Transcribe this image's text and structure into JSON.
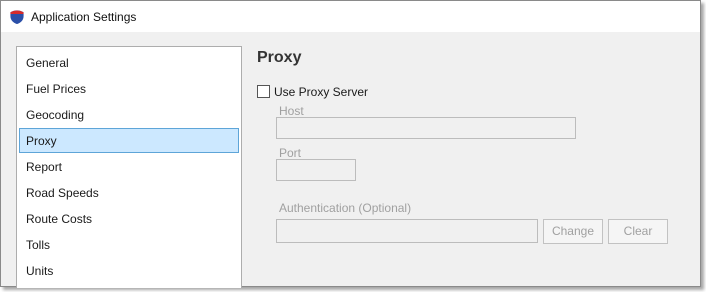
{
  "window": {
    "title": "Application Settings",
    "icon": "interstate-shield-icon"
  },
  "sidebar": {
    "items": [
      {
        "label": "General"
      },
      {
        "label": "Fuel Prices"
      },
      {
        "label": "Geocoding"
      },
      {
        "label": "Proxy",
        "selected": true
      },
      {
        "label": "Report"
      },
      {
        "label": "Road Speeds"
      },
      {
        "label": "Route Costs"
      },
      {
        "label": "Tolls"
      },
      {
        "label": "Units"
      }
    ]
  },
  "proxy": {
    "title": "Proxy",
    "use_proxy_label": "Use Proxy Server",
    "use_proxy_checked": false,
    "host_label": "Host",
    "host_value": "",
    "port_label": "Port",
    "port_value": "",
    "auth_label": "Authentication (Optional)",
    "auth_value": "",
    "change_label": "Change",
    "clear_label": "Clear"
  },
  "colors": {
    "selection_bg": "#cce8ff",
    "selection_border": "#5ea5d8",
    "disabled_text": "#a0a0a0",
    "shield_blue": "#2b4fa8",
    "shield_red": "#d62b2b"
  }
}
